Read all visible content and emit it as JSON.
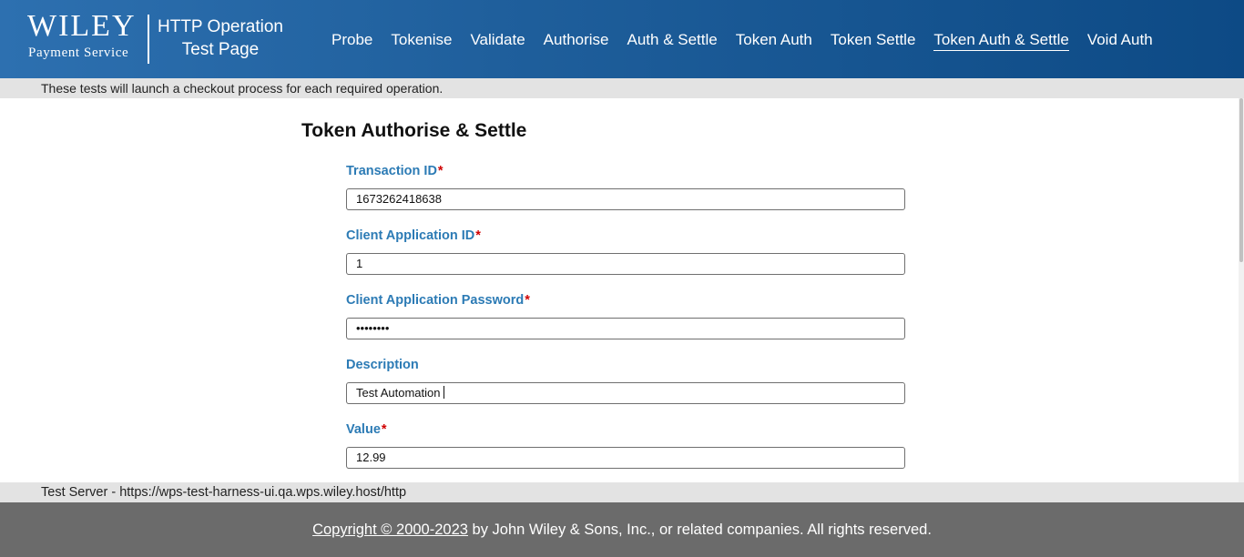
{
  "header": {
    "logo_text": "WILEY",
    "logo_subtext": "Payment Service",
    "title_line1": "HTTP Operation",
    "title_line2": "Test Page",
    "nav": [
      {
        "label": "Probe"
      },
      {
        "label": "Tokenise"
      },
      {
        "label": "Validate"
      },
      {
        "label": "Authorise"
      },
      {
        "label": "Auth & Settle"
      },
      {
        "label": "Token Auth"
      },
      {
        "label": "Token Settle"
      },
      {
        "label": "Token Auth & Settle",
        "active": true
      },
      {
        "label": "Void Auth"
      }
    ]
  },
  "info_text": "These tests will launch a checkout process for each required operation.",
  "form": {
    "title": "Token Authorise & Settle",
    "required_marker": "*",
    "fields": {
      "transaction_id": {
        "label": "Transaction ID",
        "value": "1673262418638",
        "required": true
      },
      "client_app_id": {
        "label": "Client Application ID",
        "value": "1",
        "required": true
      },
      "client_app_password": {
        "label": "Client Application Password",
        "value": "••••••••",
        "required": true
      },
      "description": {
        "label": "Description",
        "value": "Test Automation",
        "required": false
      },
      "value": {
        "label": "Value",
        "value": "12.99",
        "required": true
      }
    }
  },
  "server_text": "Test Server - https://wps-test-harness-ui.qa.wps.wiley.host/http",
  "footer": {
    "copyright_link": "Copyright © 2000-2023",
    "copyright_rest": " by John Wiley & Sons, Inc., or related companies. All rights reserved."
  },
  "colors": {
    "header_start": "#2d70b0",
    "header_end": "#0d4a85",
    "label_blue": "#2c7bb5",
    "required_red": "#d00000",
    "footer_gray": "#6b6b6b"
  }
}
